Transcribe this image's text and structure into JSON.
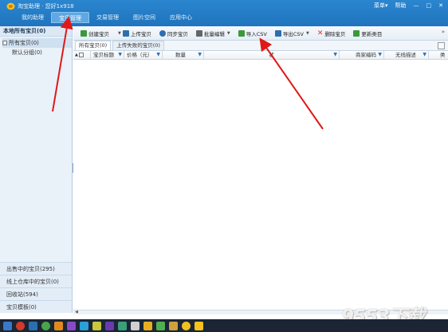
{
  "window": {
    "app_title": "淘宝助理 · 您好1x918",
    "menu_label": "菜单▾",
    "help_label": "帮助",
    "minimize": "—",
    "maximize": "□",
    "close": "✕"
  },
  "nav": {
    "tabs": [
      "我的助理",
      "宝贝管理",
      "交易管理",
      "图片空间",
      "应用中心"
    ],
    "active_index": 1
  },
  "sidebar": {
    "title": "本地所有宝贝(0)",
    "tree": [
      {
        "label": "所有宝贝(0)",
        "expander": "□"
      },
      {
        "label": "默认分组(0)"
      }
    ],
    "bottom_items": [
      "出售中的宝贝(295)",
      "线上仓库中的宝贝(0)",
      "回收站(594)",
      "宝贝模板(0)"
    ]
  },
  "toolbar": {
    "buttons": [
      {
        "label": "创建宝贝",
        "icon": "plus-icon",
        "color": "#3a9a3a"
      },
      {
        "label": "上传宝贝",
        "icon": "upload-icon",
        "color": "#2c6fb0"
      },
      {
        "label": "同步宝贝",
        "icon": "sync-icon",
        "color": "#2c6fb0"
      },
      {
        "label": "批量编辑",
        "icon": "batch-edit-icon",
        "color": "#666666"
      },
      {
        "label": "导入CSV",
        "icon": "import-csv-icon",
        "color": "#3a9a3a"
      },
      {
        "label": "导出CSV",
        "icon": "export-csv-icon",
        "color": "#2c6fb0"
      },
      {
        "label": "删除宝贝",
        "icon": "delete-icon",
        "color": "#d23a2a"
      },
      {
        "label": "更新类目",
        "icon": "refresh-category-icon",
        "color": "#3a9a3a"
      }
    ],
    "more": "»"
  },
  "subtabs": [
    "所有宝贝(0)",
    "上传失败的宝贝(0)"
  ],
  "grid": {
    "columns": [
      "宝贝标题",
      "价格（元）",
      "数量",
      "状",
      "商家编码",
      "无线描述",
      "类"
    ]
  },
  "watermark": "9553下载"
}
